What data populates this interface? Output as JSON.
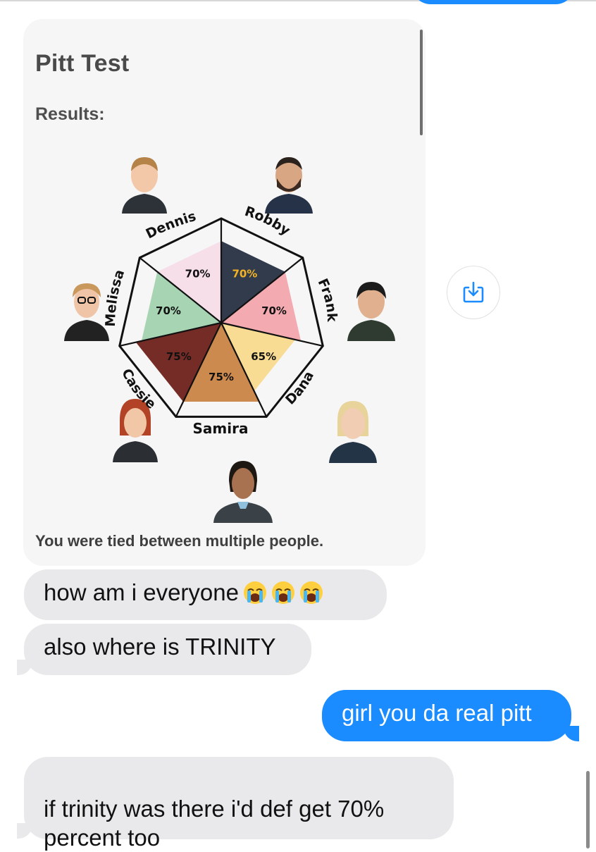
{
  "card": {
    "title": "Pitt Test",
    "subtitle": "Results:",
    "footer": "You were tied between multiple people.",
    "chart_data": {
      "type": "radar",
      "categories": [
        "Robby",
        "Frank",
        "Dana",
        "Samira",
        "Cassie",
        "Melissa",
        "Dennis"
      ],
      "values": [
        70,
        70,
        65,
        75,
        75,
        70,
        70
      ],
      "value_labels": [
        "70%",
        "70%",
        "65%",
        "75%",
        "75%",
        "70%",
        "70%"
      ],
      "ylim": [
        0,
        100
      ],
      "colors": [
        "#1f2a3c",
        "#f3a3aa",
        "#f8d98b",
        "#c88040",
        "#6a1a14",
        "#9fd0ad",
        "#f6dde8"
      ]
    }
  },
  "messages": [
    {
      "side": "incoming",
      "text": "how am i everyone",
      "emoji": "loudly-crying-face x3"
    },
    {
      "side": "incoming",
      "text": "also where is TRINITY"
    },
    {
      "side": "outgoing",
      "text": "girl you da real pitt"
    },
    {
      "side": "incoming",
      "text": "if trinity was there i'd def get 70%\npercent too"
    }
  ],
  "actions": {
    "save_icon": "save-to-photos-icon"
  }
}
